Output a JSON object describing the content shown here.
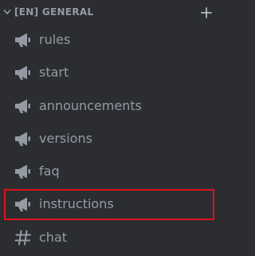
{
  "sidebar": {
    "category": {
      "label": "[EN] GENERAL",
      "chevron_icon": "chevron-down-icon",
      "add_icon": "plus-icon"
    },
    "channels": [
      {
        "label": "rules",
        "icon": "megaphone-icon"
      },
      {
        "label": "start",
        "icon": "megaphone-icon"
      },
      {
        "label": "announcements",
        "icon": "megaphone-icon"
      },
      {
        "label": "versions",
        "icon": "megaphone-icon"
      },
      {
        "label": "faq",
        "icon": "megaphone-icon"
      },
      {
        "label": "instructions",
        "icon": "megaphone-icon",
        "highlighted": true
      },
      {
        "label": "chat",
        "icon": "hash-icon"
      }
    ]
  },
  "colors": {
    "background": "#2b2d31",
    "text_muted": "#949ba4",
    "highlight_border": "#e0121c"
  }
}
